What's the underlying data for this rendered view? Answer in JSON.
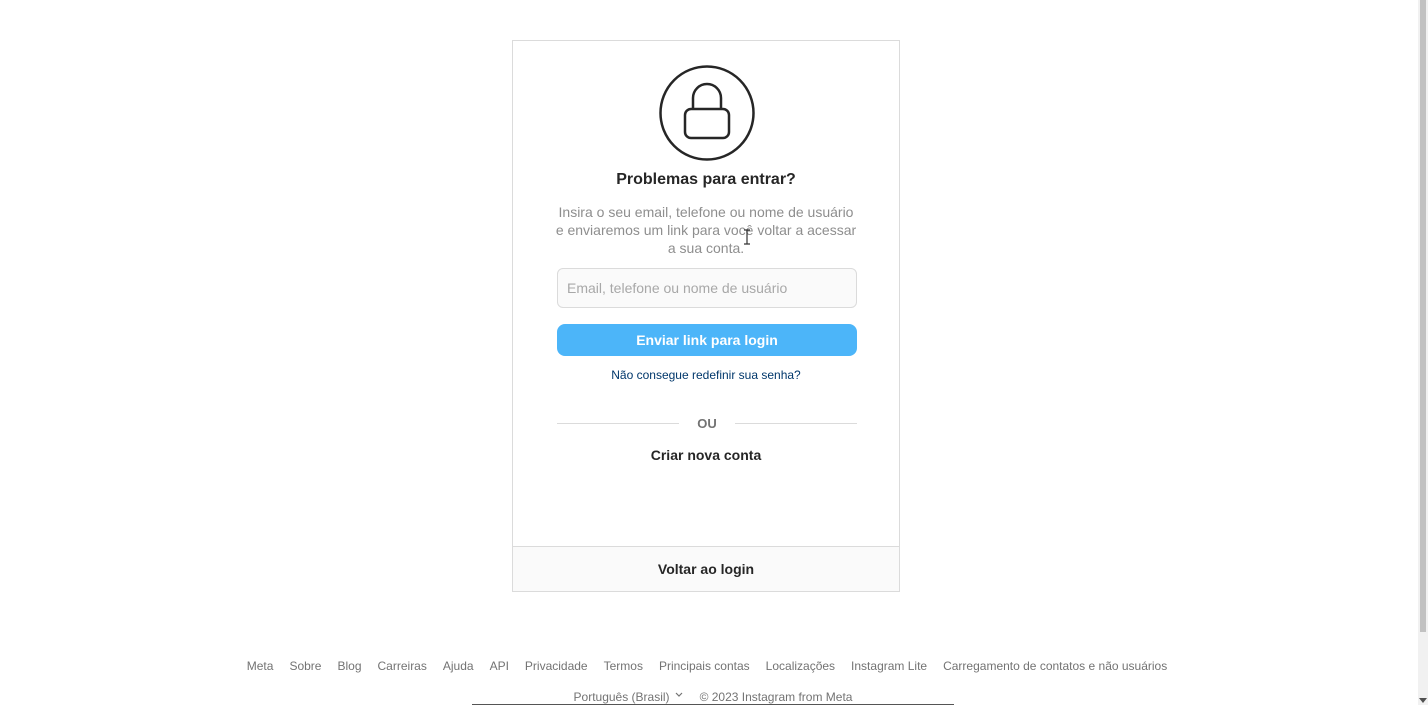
{
  "card": {
    "icon": "lock-icon",
    "title": "Problemas para entrar?",
    "description": "Insira o seu email, telefone ou nome de usuário e enviaremos um link para você voltar a acessar a sua conta.",
    "input": {
      "placeholder": "Email, telefone ou nome de usuário",
      "value": ""
    },
    "send_button_label": "Enviar link para login",
    "reset_link_label": "Não consegue redefinir sua senha?",
    "divider_label": "OU",
    "create_account_label": "Criar nova conta",
    "back_to_login_label": "Voltar ao login"
  },
  "footer": {
    "links": [
      "Meta",
      "Sobre",
      "Blog",
      "Carreiras",
      "Ajuda",
      "API",
      "Privacidade",
      "Termos",
      "Principais contas",
      "Localizações",
      "Instagram Lite",
      "Carregamento de contatos e não usuários"
    ],
    "language": "Português (Brasil)",
    "copyright": "© 2023 Instagram from Meta"
  },
  "colors": {
    "primary_button": "#4cb5f9",
    "link": "#00376b",
    "border": "#dbdbdb"
  }
}
